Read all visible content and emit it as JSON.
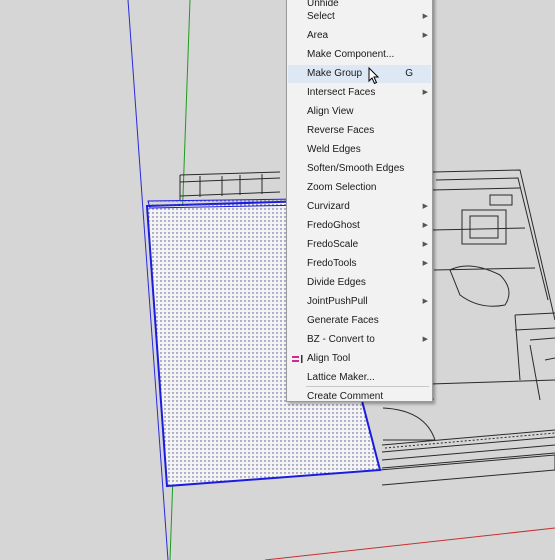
{
  "context_menu": {
    "items": [
      {
        "label": "Unhide",
        "submenu": false
      },
      {
        "label": "Select",
        "submenu": true
      },
      {
        "label": "Area",
        "submenu": true
      },
      {
        "label": "Make Component...",
        "submenu": false
      },
      {
        "label": "Make Group",
        "submenu": false,
        "shortcut": "G",
        "hovered": true
      },
      {
        "label": "Intersect Faces",
        "submenu": true
      },
      {
        "label": "Align View",
        "submenu": false
      },
      {
        "label": "Reverse Faces",
        "submenu": false
      },
      {
        "label": "Weld Edges",
        "submenu": false
      },
      {
        "label": "Soften/Smooth Edges",
        "submenu": false
      },
      {
        "label": "Zoom Selection",
        "submenu": false
      },
      {
        "label": "Curvizard",
        "submenu": true
      },
      {
        "label": "FredoGhost",
        "submenu": true
      },
      {
        "label": "FredoScale",
        "submenu": true
      },
      {
        "label": "FredoTools",
        "submenu": true
      },
      {
        "label": "Divide Edges",
        "submenu": false
      },
      {
        "label": "JointPushPull",
        "submenu": true
      },
      {
        "label": "Generate Faces",
        "submenu": false
      },
      {
        "label": "BZ - Convert to",
        "submenu": true
      },
      {
        "label": "Align Tool",
        "submenu": false,
        "icon": "align-tool-icon"
      },
      {
        "label": "Lattice Maker...",
        "submenu": false
      },
      {
        "label": "Create Comment",
        "submenu": false
      }
    ]
  },
  "colors": {
    "background": "#d6d6d6",
    "selection_blue": "#1c1ce0",
    "green_axis": "#1f9c1f",
    "blue_axis": "#2a2ad8",
    "red_axis": "#c83030",
    "menu_hover": "#dde8f4"
  }
}
